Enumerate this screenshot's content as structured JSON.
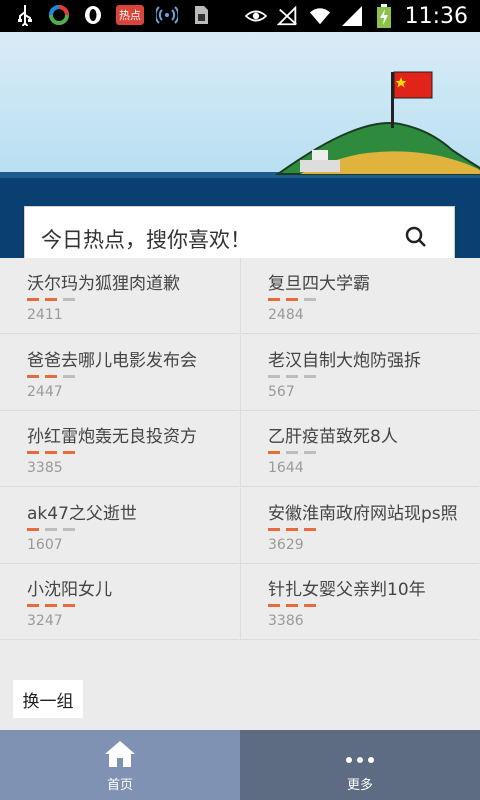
{
  "status_bar": {
    "time": "11:36",
    "hot_badge": "热点",
    "icons_left": [
      "usb-icon",
      "colorful-ring-icon",
      "opera-icon",
      "hot-news-app-icon",
      "wifi-hotspot-icon",
      "sd-card-icon"
    ],
    "icons_right": [
      "eye-icon",
      "no-signal-icon",
      "wifi-icon",
      "signal-icon",
      "battery-charging-icon"
    ]
  },
  "search": {
    "placeholder": "今日热点，搜你喜欢！"
  },
  "hot_items": [
    {
      "title": "沃尔玛为狐狸肉道歉",
      "count": "2411",
      "level": 2
    },
    {
      "title": "复旦四大学霸",
      "count": "2484",
      "level": 2
    },
    {
      "title": "爸爸去哪儿电影发布会",
      "count": "2447",
      "level": 2
    },
    {
      "title": "老汉自制大炮防强拆",
      "count": "567",
      "level": 0
    },
    {
      "title": "孙红雷炮轰无良投资方",
      "count": "3385",
      "level": 3
    },
    {
      "title": "乙肝疫苗致死8人",
      "count": "1644",
      "level": 1
    },
    {
      "title": "ak47之父逝世",
      "count": "1607",
      "level": 1
    },
    {
      "title": "安徽淮南政府网站现ps照",
      "count": "3629",
      "level": 3
    },
    {
      "title": "小沈阳女儿",
      "count": "3247",
      "level": 3
    },
    {
      "title": "针扎女婴父亲判10年",
      "count": "3386",
      "level": 3
    }
  ],
  "refresh_label": "换一组",
  "bottom_nav": {
    "home_label": "首页",
    "more_label": "更多"
  },
  "colors": {
    "accent_bar": "#e96a3a",
    "inactive_bar": "#bdbdbd",
    "nav_home": "#7f92b4",
    "nav_more": "#5d6b83"
  }
}
